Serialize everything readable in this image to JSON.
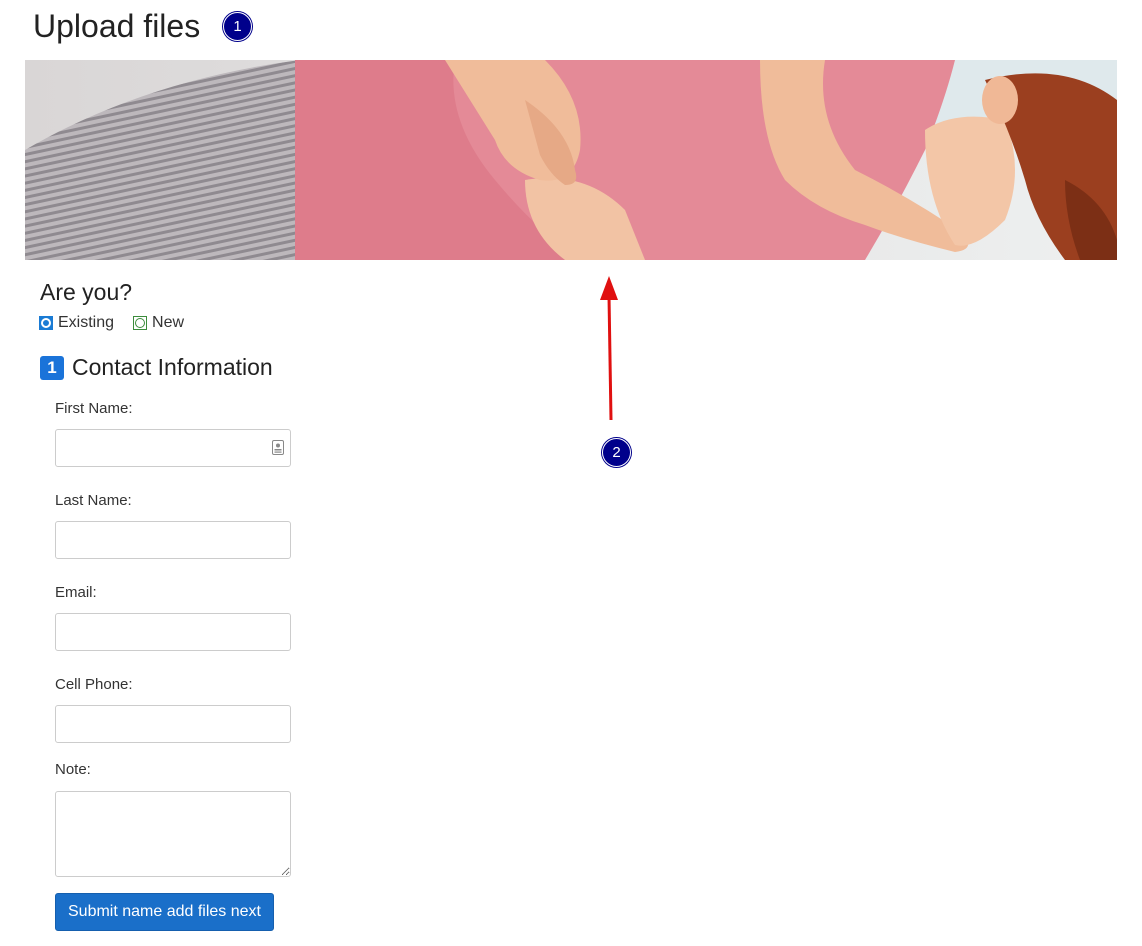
{
  "page": {
    "title": "Upload files"
  },
  "annotations": {
    "marker_1": "1",
    "marker_2": "2",
    "arrow_color": "#e01010",
    "marker_color": "#00008b"
  },
  "hero": {
    "icon": "hero-photo"
  },
  "patient_type": {
    "question": "Are you?",
    "options": [
      {
        "label": "Existing",
        "checked": true
      },
      {
        "label": "New",
        "checked": false
      }
    ]
  },
  "contact": {
    "step": "1",
    "title": "Contact Information",
    "fields": {
      "first_name": {
        "label": "First Name:",
        "value": ""
      },
      "last_name": {
        "label": "Last Name:",
        "value": ""
      },
      "email": {
        "label": "Email:",
        "value": ""
      },
      "cell_phone": {
        "label": "Cell Phone:",
        "value": ""
      },
      "note": {
        "label": "Note:",
        "value": ""
      }
    },
    "submit_label": "Submit name add files next"
  },
  "colors": {
    "primary": "#1a6fc9",
    "badge": "#1a73d9"
  }
}
